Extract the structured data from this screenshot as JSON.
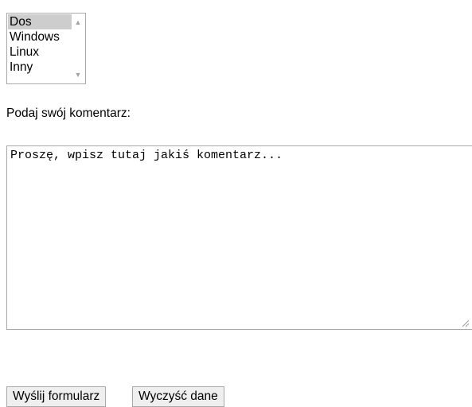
{
  "os_listbox": {
    "options": [
      "Dos",
      "Windows",
      "Linux",
      "Inny"
    ],
    "selected": "Dos"
  },
  "comment": {
    "label": "Podaj swój komentarz:",
    "value": "Proszę, wpisz tutaj jakiś komentarz..."
  },
  "buttons": {
    "submit_label": "Wyślij formularz",
    "reset_label": "Wyczyść dane"
  },
  "icons": {
    "scroll_up": "scroll-up-arrow-icon",
    "scroll_down": "scroll-down-arrow-icon",
    "resize": "resize-grip-icon"
  },
  "colors": {
    "selected_option_bg": "#cdcdcd",
    "border": "#a9a9a9",
    "button_bg": "#efefef"
  }
}
